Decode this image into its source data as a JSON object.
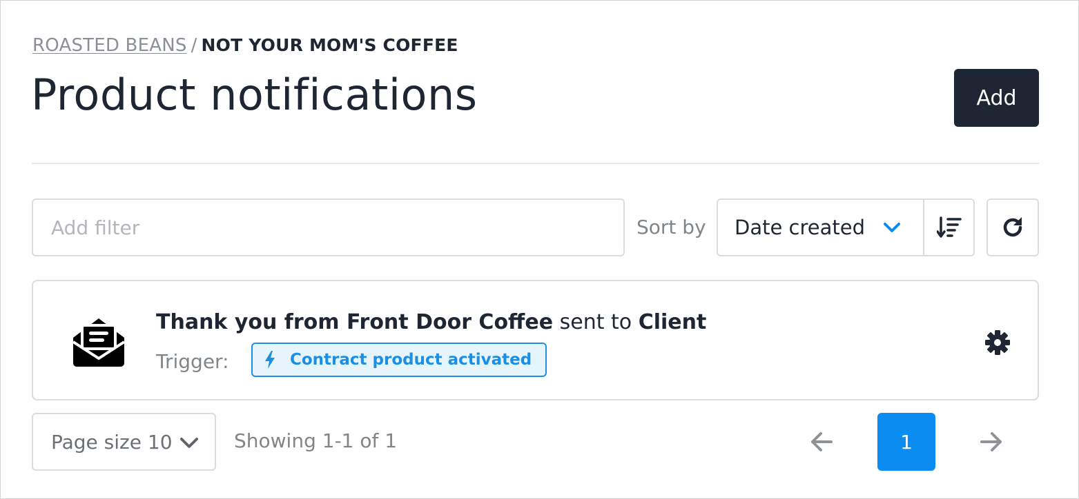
{
  "breadcrumb": {
    "parent": "ROASTED BEANS",
    "separator": "/",
    "current": "NOT YOUR MOM'S COFFEE"
  },
  "header": {
    "title": "Product notifications",
    "add_label": "Add"
  },
  "toolbar": {
    "filter_placeholder": "Add filter",
    "filter_value": "",
    "sort_label": "Sort by",
    "sort_selected": "Date created",
    "sort_direction_icon": "sort-descending-icon",
    "refresh_icon": "refresh-icon"
  },
  "notifications": [
    {
      "icon": "envelope-open-text-icon",
      "name": "Thank you from Front Door Coffee",
      "connector": "sent to",
      "recipient": "Client",
      "trigger_label": "Trigger:",
      "trigger": "Contract product activated",
      "trigger_icon": "bolt-icon",
      "settings_icon": "gear-icon"
    }
  ],
  "pagination": {
    "page_size_label": "Page size 10",
    "showing": "Showing 1-1 of 1",
    "current_page": "1"
  },
  "colors": {
    "primary_dark": "#1e2633",
    "accent_blue": "#0a8cf0",
    "badge_bg": "#e6f4fc",
    "muted": "#808589",
    "border": "#dcdcdc"
  }
}
